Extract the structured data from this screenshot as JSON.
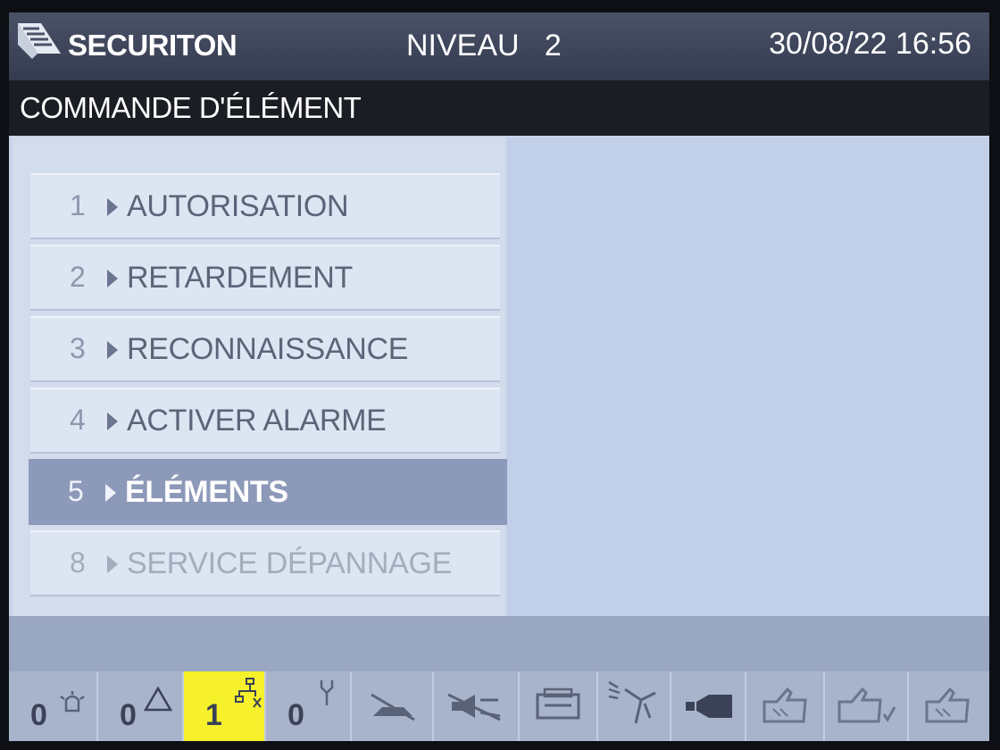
{
  "header": {
    "brand": "SECURITON",
    "level": "NIVEAU   2",
    "datetime": "30/08/22 16:56",
    "logo_icon": "securiton-logo-icon"
  },
  "title": "COMMANDE D'ÉLÉMENT",
  "menu": {
    "items": [
      {
        "number": "1",
        "label": "AUTORISATION",
        "state": "normal"
      },
      {
        "number": "2",
        "label": "RETARDEMENT",
        "state": "normal"
      },
      {
        "number": "3",
        "label": "RECONNAISSANCE",
        "state": "normal"
      },
      {
        "number": "4",
        "label": "ACTIVER ALARME",
        "state": "normal"
      },
      {
        "number": "5",
        "label": "ÉLÉMENTS",
        "state": "selected"
      },
      {
        "number": "8",
        "label": "SERVICE DÉPANNAGE",
        "state": "disabled"
      }
    ]
  },
  "statusbar": {
    "alarm_count": "0",
    "warning_count": "0",
    "fault_count": "1",
    "disabled_count": "0",
    "icons": [
      "alarm-icon",
      "warning-icon",
      "fault-icon",
      "disablement-icon",
      "detector-off-icon",
      "siren-off-icon",
      "printer-icon",
      "sprinkler-icon",
      "horn-icon",
      "hand-ok-icon",
      "hand-check-icon",
      "hand-ok-icon"
    ],
    "highlight_color": "#f6f12a"
  },
  "colors": {
    "header_bg": "#3d4358",
    "titlebar_bg": "#1b1d24",
    "screen_bg": "#c8d4ea",
    "selected_bg": "#8d99b8"
  }
}
